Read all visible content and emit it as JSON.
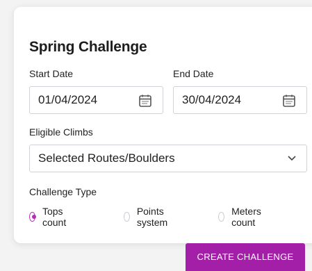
{
  "title": "Spring Challenge",
  "start_date": {
    "label": "Start Date",
    "value": "01/04/2024",
    "icon": "calendar-icon"
  },
  "end_date": {
    "label": "End Date",
    "value": "30/04/2024",
    "icon": "calendar-icon"
  },
  "eligible": {
    "label": "Eligible Climbs",
    "value": "Selected Routes/Boulders",
    "icon": "chevron-down-icon"
  },
  "challenge_type": {
    "label": "Challenge Type",
    "options": [
      {
        "label": "Tops count",
        "selected": true
      },
      {
        "label": "Points system",
        "selected": false
      },
      {
        "label": "Meters count",
        "selected": false
      }
    ]
  },
  "create_button": "CREATE CHALLENGE",
  "colors": {
    "accent": "#a31fa8",
    "radio_selected": "#b42cb8",
    "border": "#cfd3d8"
  }
}
